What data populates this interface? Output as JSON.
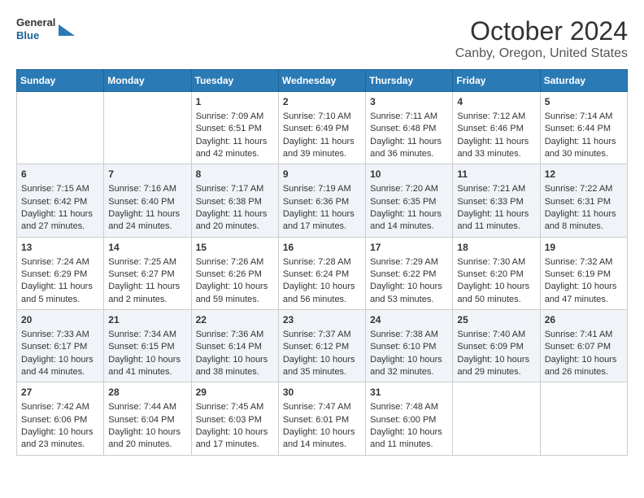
{
  "logo": {
    "line1": "General",
    "line2": "Blue"
  },
  "title": "October 2024",
  "subtitle": "Canby, Oregon, United States",
  "days_of_week": [
    "Sunday",
    "Monday",
    "Tuesday",
    "Wednesday",
    "Thursday",
    "Friday",
    "Saturday"
  ],
  "weeks": [
    [
      {
        "day": "",
        "sunrise": "",
        "sunset": "",
        "daylight": ""
      },
      {
        "day": "",
        "sunrise": "",
        "sunset": "",
        "daylight": ""
      },
      {
        "day": "1",
        "sunrise": "Sunrise: 7:09 AM",
        "sunset": "Sunset: 6:51 PM",
        "daylight": "Daylight: 11 hours and 42 minutes."
      },
      {
        "day": "2",
        "sunrise": "Sunrise: 7:10 AM",
        "sunset": "Sunset: 6:49 PM",
        "daylight": "Daylight: 11 hours and 39 minutes."
      },
      {
        "day": "3",
        "sunrise": "Sunrise: 7:11 AM",
        "sunset": "Sunset: 6:48 PM",
        "daylight": "Daylight: 11 hours and 36 minutes."
      },
      {
        "day": "4",
        "sunrise": "Sunrise: 7:12 AM",
        "sunset": "Sunset: 6:46 PM",
        "daylight": "Daylight: 11 hours and 33 minutes."
      },
      {
        "day": "5",
        "sunrise": "Sunrise: 7:14 AM",
        "sunset": "Sunset: 6:44 PM",
        "daylight": "Daylight: 11 hours and 30 minutes."
      }
    ],
    [
      {
        "day": "6",
        "sunrise": "Sunrise: 7:15 AM",
        "sunset": "Sunset: 6:42 PM",
        "daylight": "Daylight: 11 hours and 27 minutes."
      },
      {
        "day": "7",
        "sunrise": "Sunrise: 7:16 AM",
        "sunset": "Sunset: 6:40 PM",
        "daylight": "Daylight: 11 hours and 24 minutes."
      },
      {
        "day": "8",
        "sunrise": "Sunrise: 7:17 AM",
        "sunset": "Sunset: 6:38 PM",
        "daylight": "Daylight: 11 hours and 20 minutes."
      },
      {
        "day": "9",
        "sunrise": "Sunrise: 7:19 AM",
        "sunset": "Sunset: 6:36 PM",
        "daylight": "Daylight: 11 hours and 17 minutes."
      },
      {
        "day": "10",
        "sunrise": "Sunrise: 7:20 AM",
        "sunset": "Sunset: 6:35 PM",
        "daylight": "Daylight: 11 hours and 14 minutes."
      },
      {
        "day": "11",
        "sunrise": "Sunrise: 7:21 AM",
        "sunset": "Sunset: 6:33 PM",
        "daylight": "Daylight: 11 hours and 11 minutes."
      },
      {
        "day": "12",
        "sunrise": "Sunrise: 7:22 AM",
        "sunset": "Sunset: 6:31 PM",
        "daylight": "Daylight: 11 hours and 8 minutes."
      }
    ],
    [
      {
        "day": "13",
        "sunrise": "Sunrise: 7:24 AM",
        "sunset": "Sunset: 6:29 PM",
        "daylight": "Daylight: 11 hours and 5 minutes."
      },
      {
        "day": "14",
        "sunrise": "Sunrise: 7:25 AM",
        "sunset": "Sunset: 6:27 PM",
        "daylight": "Daylight: 11 hours and 2 minutes."
      },
      {
        "day": "15",
        "sunrise": "Sunrise: 7:26 AM",
        "sunset": "Sunset: 6:26 PM",
        "daylight": "Daylight: 10 hours and 59 minutes."
      },
      {
        "day": "16",
        "sunrise": "Sunrise: 7:28 AM",
        "sunset": "Sunset: 6:24 PM",
        "daylight": "Daylight: 10 hours and 56 minutes."
      },
      {
        "day": "17",
        "sunrise": "Sunrise: 7:29 AM",
        "sunset": "Sunset: 6:22 PM",
        "daylight": "Daylight: 10 hours and 53 minutes."
      },
      {
        "day": "18",
        "sunrise": "Sunrise: 7:30 AM",
        "sunset": "Sunset: 6:20 PM",
        "daylight": "Daylight: 10 hours and 50 minutes."
      },
      {
        "day": "19",
        "sunrise": "Sunrise: 7:32 AM",
        "sunset": "Sunset: 6:19 PM",
        "daylight": "Daylight: 10 hours and 47 minutes."
      }
    ],
    [
      {
        "day": "20",
        "sunrise": "Sunrise: 7:33 AM",
        "sunset": "Sunset: 6:17 PM",
        "daylight": "Daylight: 10 hours and 44 minutes."
      },
      {
        "day": "21",
        "sunrise": "Sunrise: 7:34 AM",
        "sunset": "Sunset: 6:15 PM",
        "daylight": "Daylight: 10 hours and 41 minutes."
      },
      {
        "day": "22",
        "sunrise": "Sunrise: 7:36 AM",
        "sunset": "Sunset: 6:14 PM",
        "daylight": "Daylight: 10 hours and 38 minutes."
      },
      {
        "day": "23",
        "sunrise": "Sunrise: 7:37 AM",
        "sunset": "Sunset: 6:12 PM",
        "daylight": "Daylight: 10 hours and 35 minutes."
      },
      {
        "day": "24",
        "sunrise": "Sunrise: 7:38 AM",
        "sunset": "Sunset: 6:10 PM",
        "daylight": "Daylight: 10 hours and 32 minutes."
      },
      {
        "day": "25",
        "sunrise": "Sunrise: 7:40 AM",
        "sunset": "Sunset: 6:09 PM",
        "daylight": "Daylight: 10 hours and 29 minutes."
      },
      {
        "day": "26",
        "sunrise": "Sunrise: 7:41 AM",
        "sunset": "Sunset: 6:07 PM",
        "daylight": "Daylight: 10 hours and 26 minutes."
      }
    ],
    [
      {
        "day": "27",
        "sunrise": "Sunrise: 7:42 AM",
        "sunset": "Sunset: 6:06 PM",
        "daylight": "Daylight: 10 hours and 23 minutes."
      },
      {
        "day": "28",
        "sunrise": "Sunrise: 7:44 AM",
        "sunset": "Sunset: 6:04 PM",
        "daylight": "Daylight: 10 hours and 20 minutes."
      },
      {
        "day": "29",
        "sunrise": "Sunrise: 7:45 AM",
        "sunset": "Sunset: 6:03 PM",
        "daylight": "Daylight: 10 hours and 17 minutes."
      },
      {
        "day": "30",
        "sunrise": "Sunrise: 7:47 AM",
        "sunset": "Sunset: 6:01 PM",
        "daylight": "Daylight: 10 hours and 14 minutes."
      },
      {
        "day": "31",
        "sunrise": "Sunrise: 7:48 AM",
        "sunset": "Sunset: 6:00 PM",
        "daylight": "Daylight: 10 hours and 11 minutes."
      },
      {
        "day": "",
        "sunrise": "",
        "sunset": "",
        "daylight": ""
      },
      {
        "day": "",
        "sunrise": "",
        "sunset": "",
        "daylight": ""
      }
    ]
  ]
}
